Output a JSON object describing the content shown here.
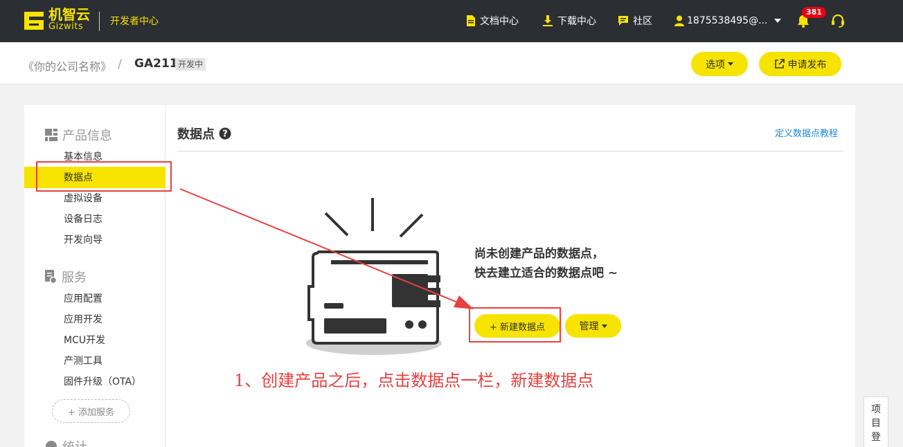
{
  "topbar": {
    "logo_zh": "机智云",
    "logo_en": "Gizwits",
    "dev_center": "开发者中心",
    "docs": "文档中心",
    "downloads": "下载中心",
    "community": "社区",
    "user": "1875538495@...",
    "notification_count": "381"
  },
  "subheader": {
    "company": "《你的公司名称》",
    "separator": "/",
    "product": "GA211",
    "status_tag": "开发中",
    "options_button": "选项",
    "publish_button": "申请发布"
  },
  "sidebar": {
    "group_product": "产品信息",
    "product_items": [
      "基本信息",
      "数据点",
      "虚拟设备",
      "设备日志",
      "开发向导"
    ],
    "group_service": "服务",
    "service_items": [
      "应用配置",
      "应用开发",
      "MCU开发",
      "产测工具",
      "固件升级（OTA）"
    ],
    "add_service": "+ 添加服务",
    "group_next": "统计"
  },
  "main": {
    "title": "数据点",
    "tutorial_link": "定义数据点教程",
    "empty_line1": "尚未创建产品的数据点，",
    "empty_line2": "快去建立适合的数据点吧 ~",
    "new_button": "+ 新建数据点",
    "manage_button": "管理"
  },
  "annotation": "1、创建产品之后，点击数据点一栏，新建数据点",
  "float_panel": "项目登",
  "colors": {
    "accent": "#f7e300",
    "topbar": "#2b2e33",
    "annotation_red": "#e84040",
    "link_blue": "#1e88e5"
  }
}
